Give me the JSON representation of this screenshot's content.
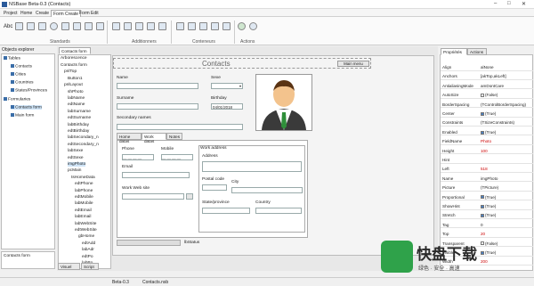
{
  "window": {
    "title": "NSBase Beta-0.3 (Contacts)",
    "min": "–",
    "max": "□",
    "close": "✕"
  },
  "menu": [
    "Project",
    "Home",
    "Create",
    "Form Create",
    "Form Edit"
  ],
  "ribbon": {
    "groups": [
      "Standards",
      "Additionners",
      "Conteneurs",
      "Actions"
    ],
    "abc": "Abc"
  },
  "explorer": {
    "title": "Objects explorer",
    "tables_label": "Tables",
    "tables": [
      "Contacts",
      "Cities",
      "Countries",
      "States/Provinces"
    ],
    "forms_label": "Formularies",
    "forms": [
      "Contacts form",
      "Main form"
    ],
    "bottom": "Contacts form"
  },
  "doc_tab": "Contacts form",
  "tree": {
    "title": "Arborescence",
    "items": [
      "Contacts form",
      "pnlTop",
      "Button1",
      "pnlLayout",
      "shPhoto",
      "labName",
      "edtName",
      "labSurname",
      "edtSurname",
      "labBirthday",
      "edtBirthday",
      "labSecondary_n",
      "edtSecondary_n",
      "labSexe",
      "edtSexe",
      "imgPhoto",
      "pcMain",
      "tsHomeData",
      "edtPhone",
      "labPhone",
      "edtMobile",
      "labMobile",
      "edtEmail",
      "labEmail",
      "labWebSite",
      "edtWebSite",
      "gbHome",
      "edtAdd",
      "labAdr",
      "edtPo",
      "labPo",
      "edtCity",
      "cbCity"
    ]
  },
  "bottom_tabs": [
    "Visuel",
    "Script"
  ],
  "form": {
    "title": "Contacts",
    "menu_btn": "Main menu",
    "name": "Name",
    "sexe": "Sexe",
    "surname": "Surname",
    "birthday": "Birthday",
    "birthday_value": "04/01/2018",
    "secondary": "Secondary names",
    "tabs": [
      "Home datas",
      "Work datas",
      "Notes"
    ],
    "phone": "Phone",
    "mobile": "Mobile",
    "email": "Email",
    "website": "Work Web site",
    "work_address": "Work address",
    "address": "Address",
    "postal": "Postal code",
    "city": "City",
    "state": "State/province",
    "country": "Country",
    "status": "lbStatus",
    "mask": "__ __ __ __"
  },
  "props": {
    "tabs": [
      "Propriétés",
      "Actions"
    ],
    "rows": [
      [
        "Align",
        "alNone",
        ""
      ],
      [
        "Anchors",
        "[akTop,akLeft]",
        ""
      ],
      [
        "AntialiasingMode",
        "amDontCare",
        ""
      ],
      [
        "AutoSize",
        "(False)",
        "cb"
      ],
      [
        "BorderSpacing",
        "(TControlBorderSpacing)",
        ""
      ],
      [
        "Center",
        "(True)",
        "cbon"
      ],
      [
        "Constraints",
        "(TSizeConstraints)",
        ""
      ],
      [
        "Enabled",
        "(True)",
        "cbon"
      ],
      [
        "FieldName",
        "Photo",
        "red"
      ],
      [
        "Height",
        "100",
        "red"
      ],
      [
        "Hint",
        "",
        ""
      ],
      [
        "Left",
        "518",
        "red"
      ],
      [
        "Name",
        "imgPhoto",
        ""
      ],
      [
        "Picture",
        "(TPicture)",
        ""
      ],
      [
        "Proportional",
        "(True)",
        "cbon"
      ],
      [
        "ShowHint",
        "(True)",
        "cbon"
      ],
      [
        "Stretch",
        "(True)",
        "cbon"
      ],
      [
        "Tag",
        "0",
        ""
      ],
      [
        "Top",
        "20",
        "red"
      ],
      [
        "Transparent",
        "(False)",
        "cb"
      ],
      [
        "Visible",
        "(True)",
        "cbon"
      ],
      [
        "Width",
        "200",
        "red"
      ]
    ]
  },
  "status": {
    "version": "Beta-0.3",
    "file": "Contacts.nsb"
  },
  "watermark": {
    "text": "快盘下载",
    "sub": "绿色 · 安全 · 高速"
  }
}
